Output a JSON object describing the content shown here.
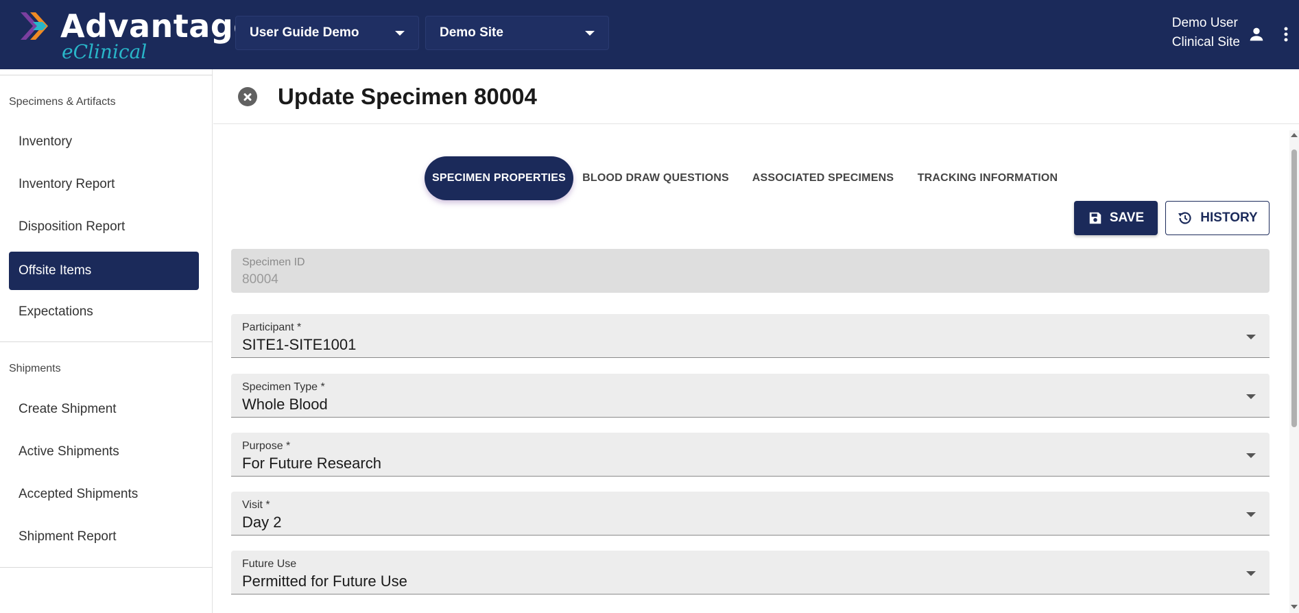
{
  "app": {
    "logo_text": "Advantage",
    "logo_subtext": "eClinical",
    "study_selector": "User Guide Demo",
    "site_selector": "Demo Site",
    "user_name": "Demo User",
    "user_role": "Clinical Site"
  },
  "sidebar": {
    "sections": [
      {
        "title": "Specimens & Artifacts",
        "items": [
          "Inventory",
          "Inventory Report",
          "Disposition Report",
          "Offsite Items",
          "Expectations"
        ]
      },
      {
        "title": "Shipments",
        "items": [
          "Create Shipment",
          "Active Shipments",
          "Accepted Shipments",
          "Shipment Report"
        ]
      }
    ],
    "active_item": "Offsite Items"
  },
  "page": {
    "title": "Update Specimen 80004",
    "tabs": [
      "SPECIMEN PROPERTIES",
      "BLOOD DRAW QUESTIONS",
      "ASSOCIATED SPECIMENS",
      "TRACKING INFORMATION"
    ],
    "active_tab": "SPECIMEN PROPERTIES",
    "save_label": "SAVE",
    "history_label": "HISTORY"
  },
  "form": {
    "specimen_id": {
      "label": "Specimen ID",
      "value": "80004"
    },
    "participant": {
      "label": "Participant *",
      "value": "SITE1-SITE1001"
    },
    "specimen_type": {
      "label": "Specimen Type *",
      "value": "Whole Blood"
    },
    "purpose": {
      "label": "Purpose *",
      "value": "For Future Research"
    },
    "visit": {
      "label": "Visit *",
      "value": "Day 2"
    },
    "future_use": {
      "label": "Future Use",
      "value": "Permitted for Future Use"
    }
  },
  "colors": {
    "primary_navy": "#1b2a5a",
    "logo_accent_teal": "#29b6c9",
    "logo_accent_orange": "#f08a24",
    "logo_accent_purple": "#7b3fa0"
  },
  "icons": [
    "advantage-logo-icon",
    "chevron-down-icon",
    "person-icon",
    "more-vert-icon",
    "close-circle-icon",
    "save-icon",
    "history-icon"
  ]
}
